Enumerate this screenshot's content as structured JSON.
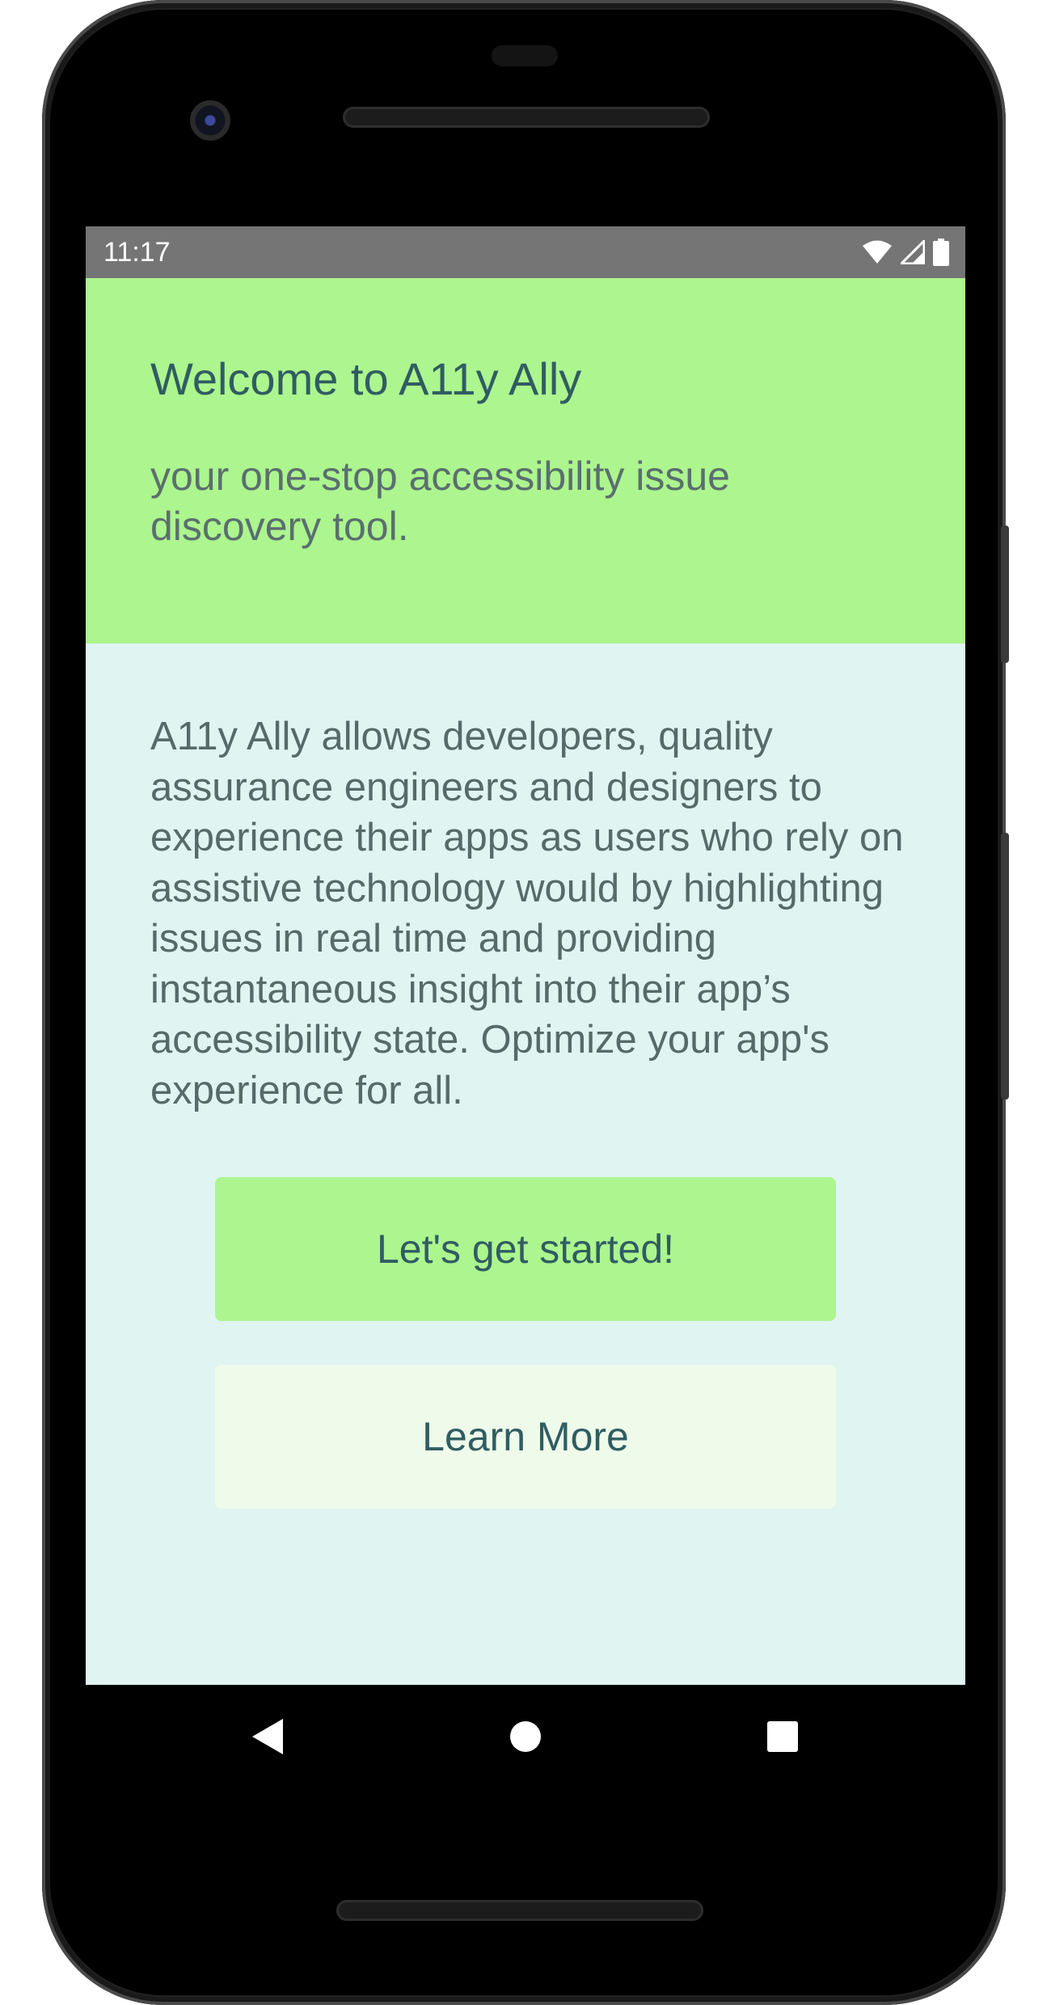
{
  "status_bar": {
    "time": "11:17",
    "icons": [
      "wifi-icon",
      "signal-icon",
      "battery-icon"
    ]
  },
  "header": {
    "title": "Welcome to A11y Ally",
    "subtitle": "your one-stop accessibility issue discovery tool."
  },
  "main": {
    "description": "A11y Ally allows developers, quality assurance engineers and designers to experience their apps as users who rely on assistive technology would by highlighting issues in real time and providing instantaneous insight into their app’s accessibility state. Optimize your app's experience for all.",
    "primary_button": "Let's get started!",
    "secondary_button": "Learn More"
  },
  "nav_bar": {
    "icons": [
      "back-icon",
      "home-icon",
      "recents-icon"
    ]
  },
  "colors": {
    "header_bg": "#adf58e",
    "screen_bg": "#e0f4f2",
    "primary_button_bg": "#adf58e",
    "secondary_button_bg": "#eefbea",
    "text_dark": "#2f5d62",
    "status_bar_bg": "#757575"
  }
}
